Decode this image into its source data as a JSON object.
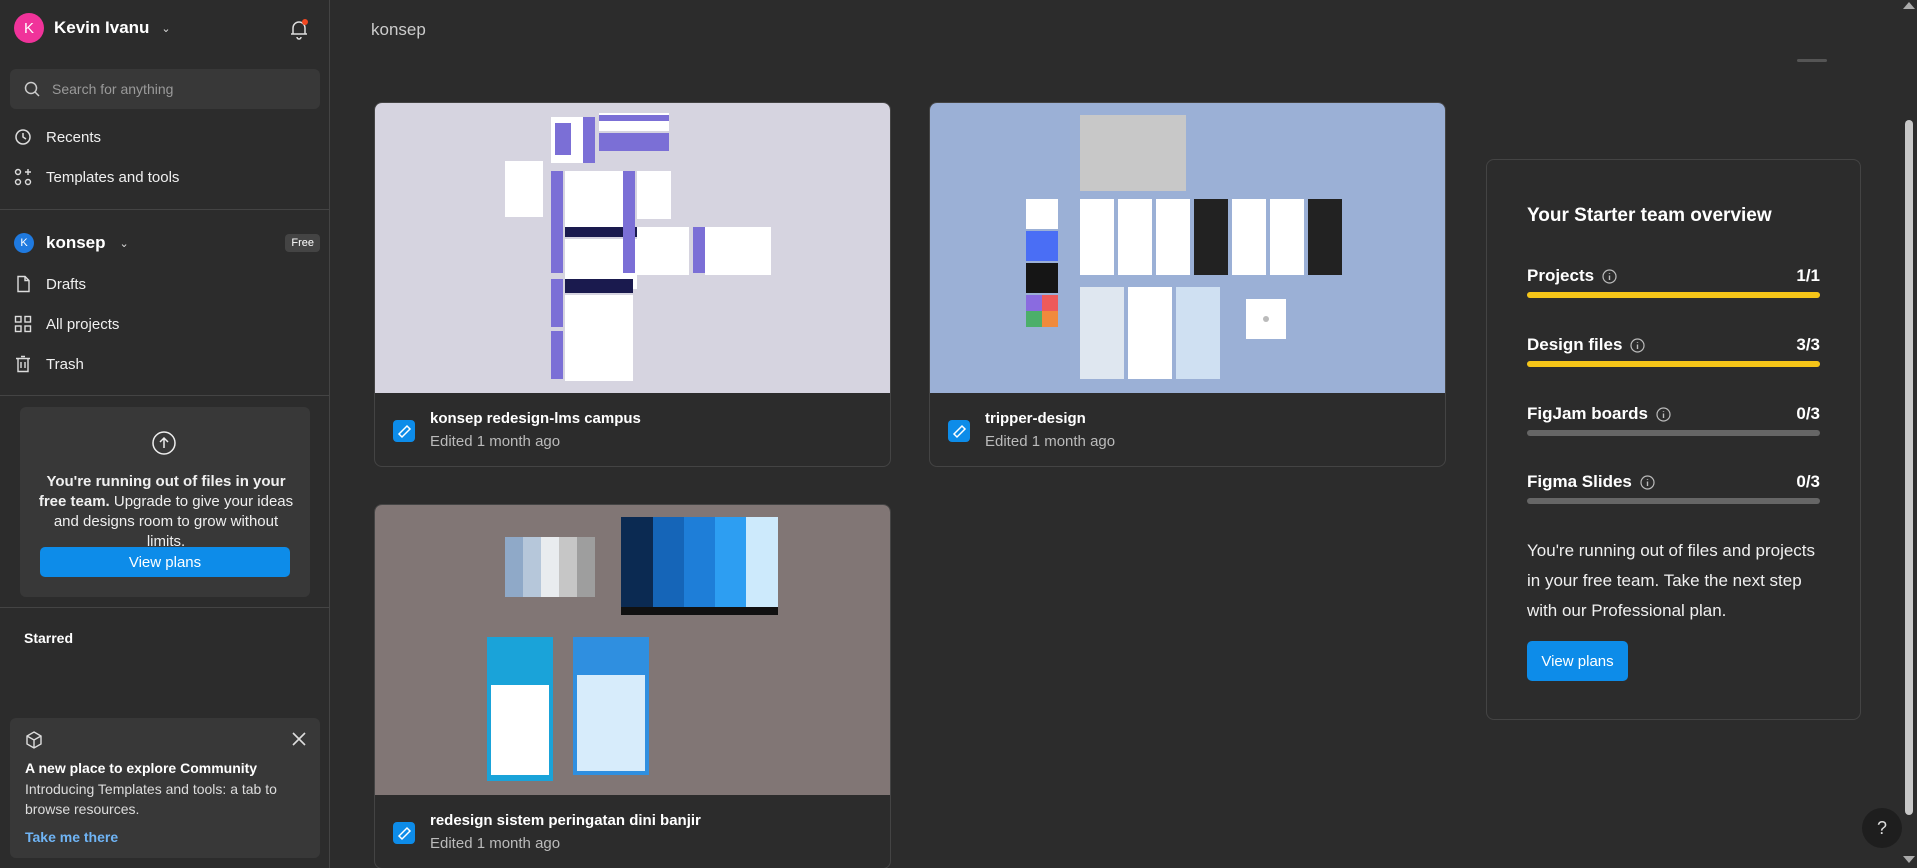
{
  "user": {
    "initial": "K",
    "name": "Kevin Ivanu"
  },
  "search": {
    "placeholder": "Search for anything"
  },
  "nav": {
    "recents": "Recents",
    "templates": "Templates and tools"
  },
  "team": {
    "initial": "K",
    "name": "konsep",
    "badge": "Free",
    "drafts": "Drafts",
    "all_projects": "All projects",
    "trash": "Trash"
  },
  "upgrade": {
    "bold": "You're running out of files in your free team.",
    "rest": " Upgrade to give your ideas and designs room to grow without limits.",
    "button": "View plans"
  },
  "starred": "Starred",
  "community": {
    "title": "A new place to explore Community",
    "desc": "Introducing Templates and tools: a tab to browse resources.",
    "link": "Take me there"
  },
  "breadcrumb": "konsep",
  "files": [
    {
      "name": "konsep redesign-lms campus",
      "meta": "Edited 1 month ago"
    },
    {
      "name": "tripper-design",
      "meta": "Edited 1 month ago"
    },
    {
      "name": "redesign sistem peringatan dini banjir",
      "meta": "Edited 1 month ago"
    }
  ],
  "overview": {
    "title": "Your Starter team overview",
    "rows": [
      {
        "label": "Projects",
        "count": "1/1",
        "fill": 1.0
      },
      {
        "label": "Design files",
        "count": "3/3",
        "fill": 1.0
      },
      {
        "label": "FigJam boards",
        "count": "0/3",
        "fill": 0
      },
      {
        "label": "Figma Slides",
        "count": "0/3",
        "fill": 0
      }
    ],
    "text": "You're running out of files and projects in your free team. Take the next step with our Professional plan.",
    "button": "View plans"
  },
  "help": "?",
  "colors": {
    "accent": "#0d8ce9",
    "progress": "#f5c518",
    "avatar": "#f0339a",
    "team": "#1f7ae0"
  }
}
